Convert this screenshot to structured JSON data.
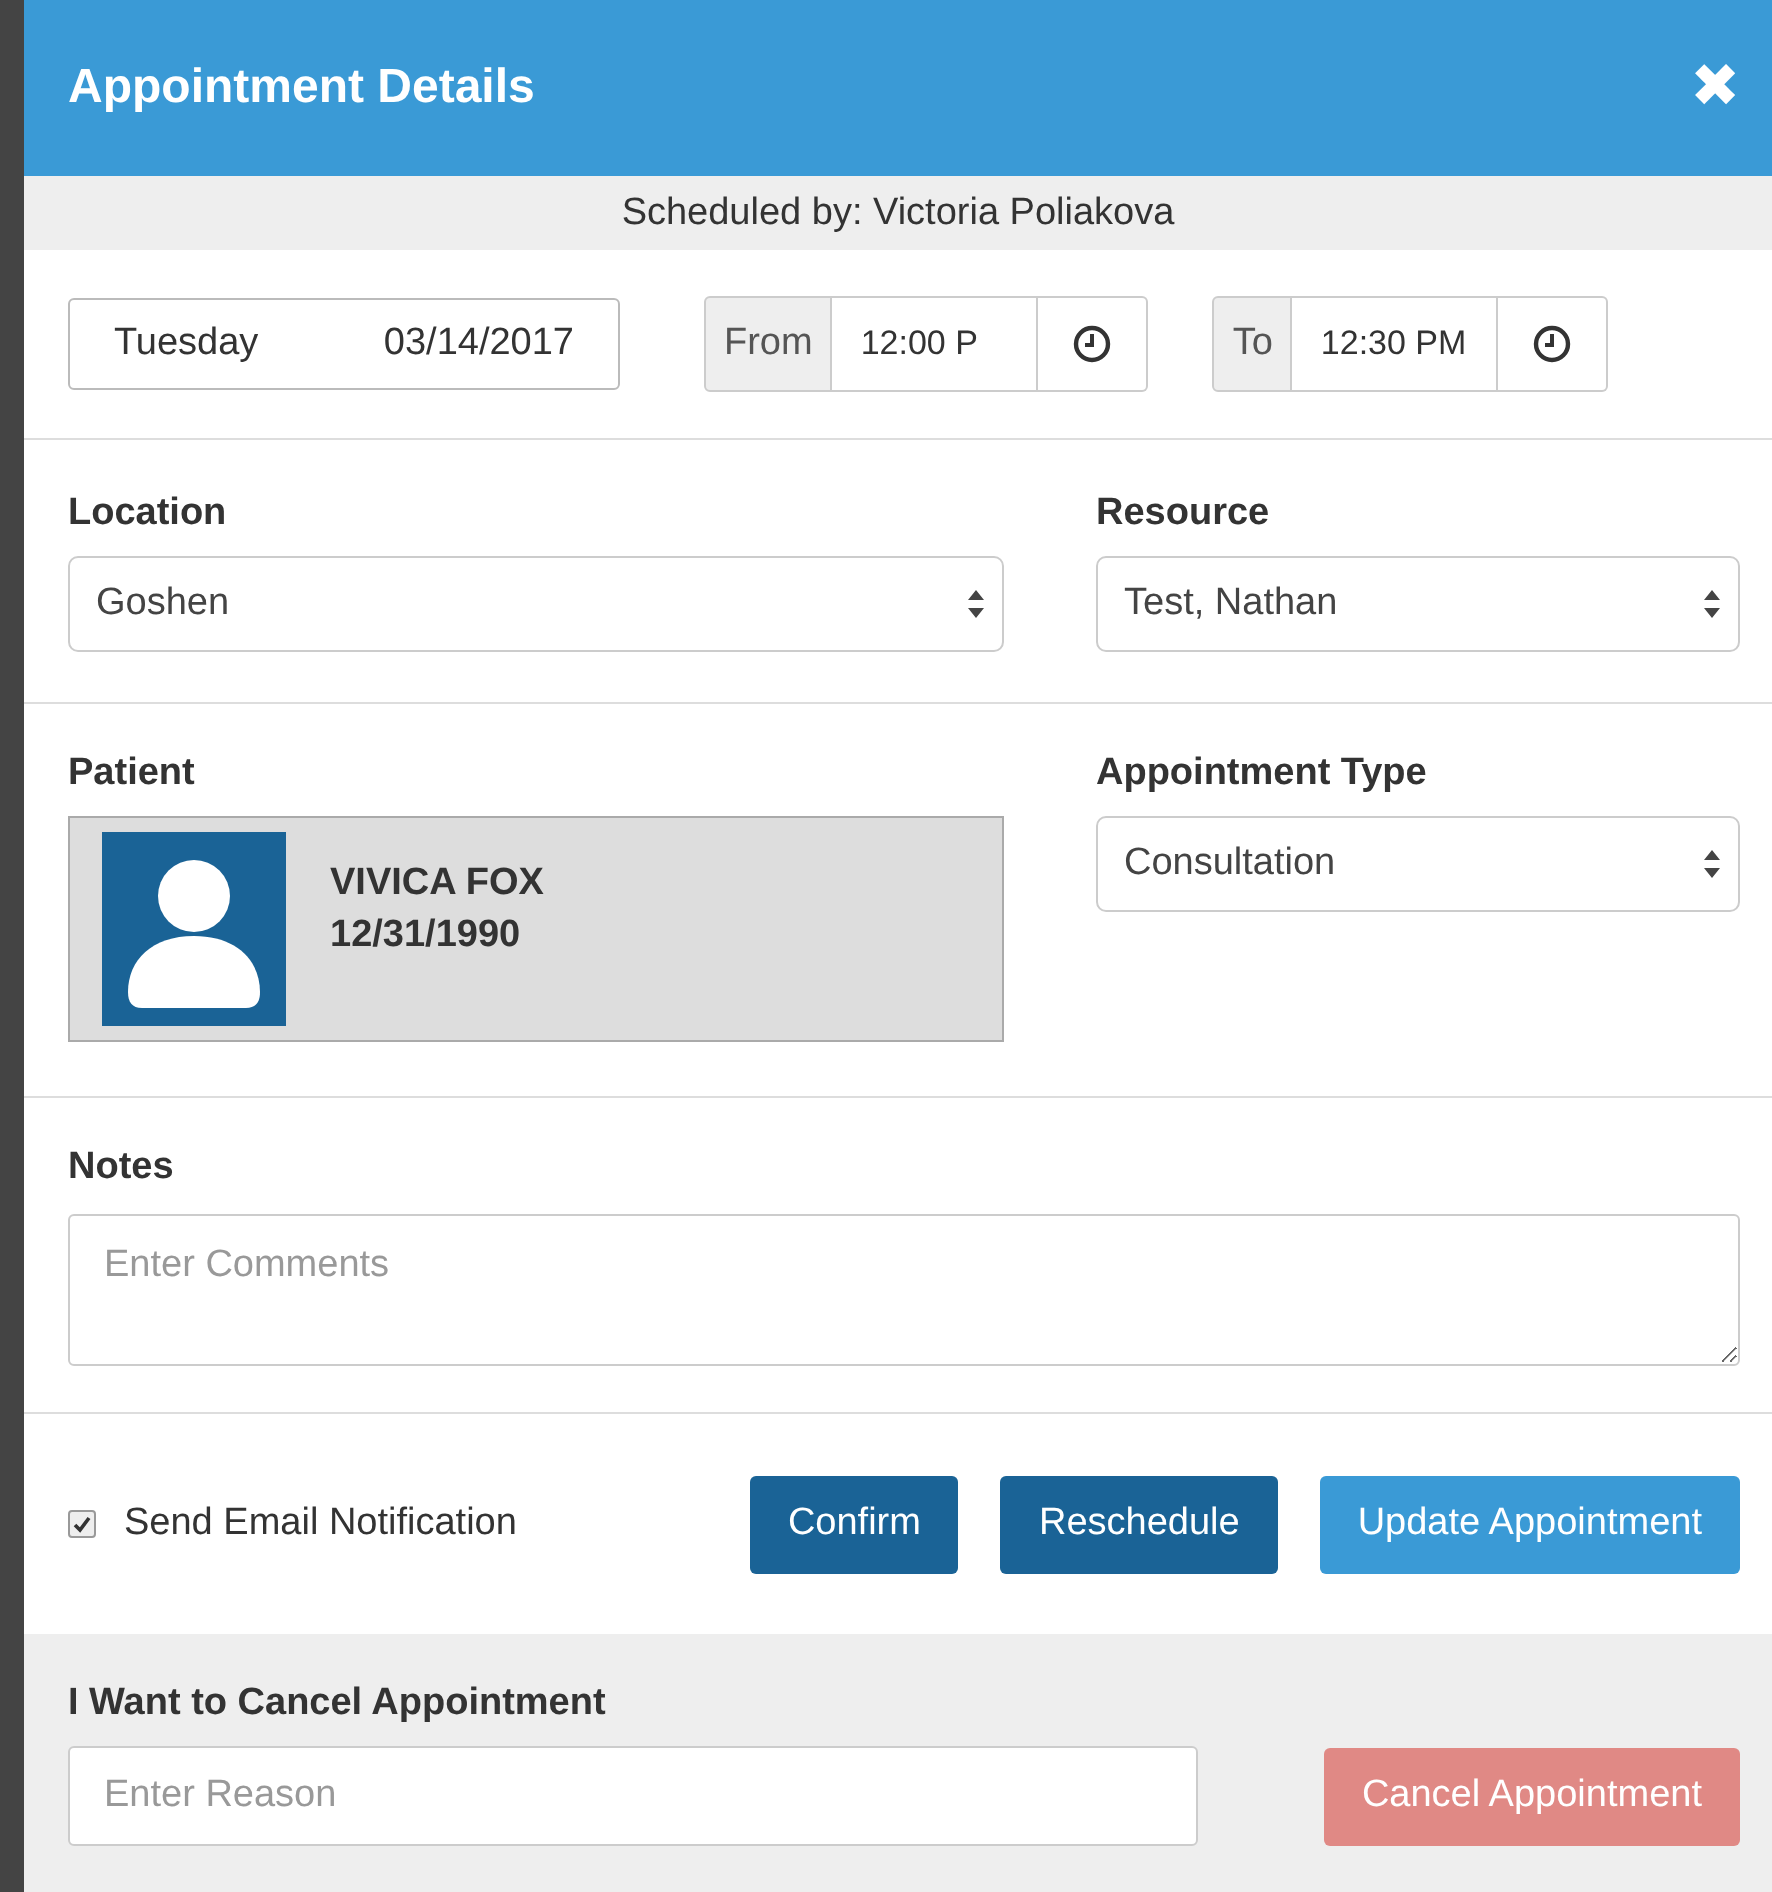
{
  "dialog": {
    "title": "Appointment Details",
    "close": "✖"
  },
  "scheduled_by": "Scheduled by: Victoria Poliakova",
  "date": {
    "day": "Tuesday",
    "value": "03/14/2017"
  },
  "time": [
    {
      "label": "From",
      "value": "12:00 P"
    },
    {
      "label": "To",
      "value": "12:30 PM"
    }
  ],
  "selects": [
    {
      "label": "Location",
      "value": "Goshen"
    },
    {
      "label": "Resource",
      "value": "Test, Nathan"
    }
  ],
  "patient": {
    "label": "Patient",
    "name": "VIVICA FOX",
    "dob": "12/31/1990"
  },
  "appointment_type": {
    "label": "Appointment Type",
    "value": "Consultation"
  },
  "notes": {
    "label": "Notes",
    "placeholder": "Enter Comments"
  },
  "email_notification": {
    "label": "Send Email Notification",
    "checked": true
  },
  "buttons": [
    {
      "label": "Confirm",
      "kind": "dark"
    },
    {
      "label": "Reschedule",
      "kind": "dark"
    },
    {
      "label": "Update Appointment",
      "kind": "primary"
    }
  ],
  "cancel": {
    "label": "I Want to Cancel Appointment",
    "placeholder": "Enter Reason",
    "button": "Cancel Appointment",
    "disabled": true
  }
}
